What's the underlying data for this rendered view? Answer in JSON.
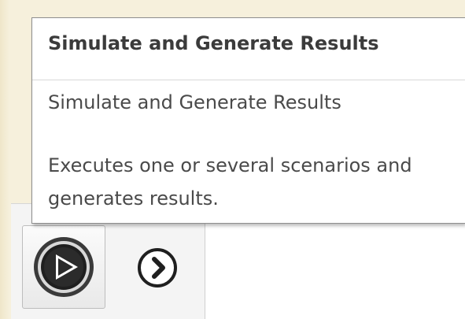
{
  "tooltip": {
    "title": "Simulate and Generate Results",
    "subtitle": "Simulate and Generate Results",
    "description": "Executes one or several scenarios and generates results."
  },
  "ribbon": {
    "buttons": [
      {
        "icon": "play-circle-icon"
      },
      {
        "icon": "chevron-right-circle-icon"
      }
    ]
  },
  "colors": {
    "tooltip_border": "#8e8e8e",
    "tooltip_text": "#4a4a4a",
    "background": "#f3ecd3"
  }
}
